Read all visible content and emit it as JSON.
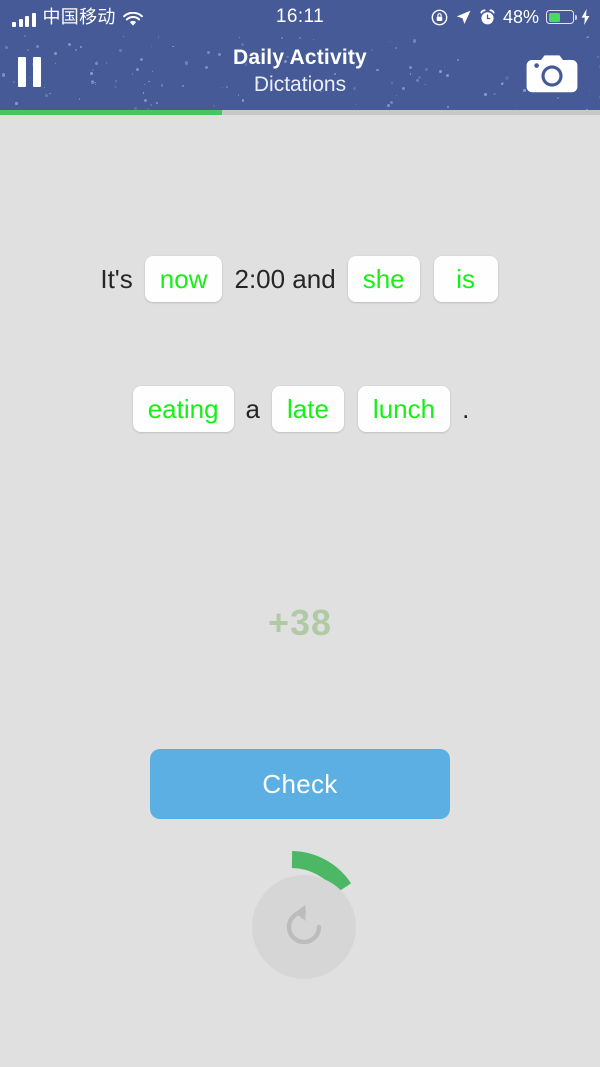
{
  "status_bar": {
    "carrier": "中国移动",
    "time": "16:11",
    "battery_percent": "48%",
    "icons": [
      "signal-bars-icon",
      "wifi-icon",
      "rotation-lock-icon",
      "location-arrow-icon",
      "alarm-clock-icon",
      "battery-icon",
      "charging-bolt-icon"
    ]
  },
  "header": {
    "title": "Daily Activity",
    "subtitle": "Dictations",
    "pause_icon": "pause-icon",
    "camera_icon": "camera-icon",
    "background_color": "#455a96"
  },
  "progress": {
    "percent": 37,
    "fill_color": "#4cc45e",
    "track_color": "#c8c8c8"
  },
  "exercise": {
    "line1": [
      {
        "type": "static",
        "text": "It's"
      },
      {
        "type": "answer",
        "text": "now"
      },
      {
        "type": "static",
        "text": "2:00 and"
      },
      {
        "type": "answer",
        "text": "she"
      },
      {
        "type": "answer",
        "text": "is"
      }
    ],
    "line2": [
      {
        "type": "answer",
        "text": "eating"
      },
      {
        "type": "static",
        "text": "a"
      },
      {
        "type": "answer",
        "text": "late"
      },
      {
        "type": "answer",
        "text": "lunch"
      },
      {
        "type": "static",
        "text": "."
      }
    ],
    "answer_color": "#17f017",
    "static_color": "#262626"
  },
  "score": {
    "text": "+38",
    "color": "#a9c79c"
  },
  "check_button": {
    "label": "Check",
    "color": "#5bafe2"
  },
  "replay": {
    "icon": "replay-rotate-left-icon",
    "arc_color": "#4cb866",
    "circle_color": "#d6d6d6"
  }
}
